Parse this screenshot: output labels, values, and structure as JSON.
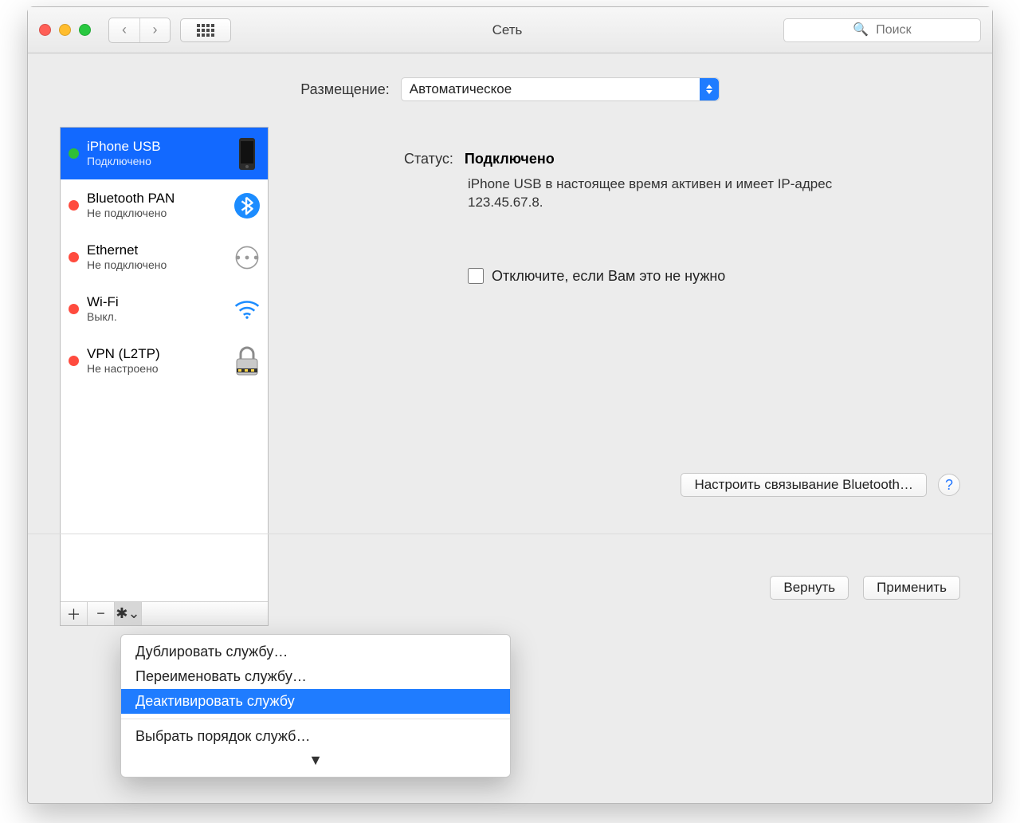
{
  "window": {
    "title": "Сеть"
  },
  "toolbar": {
    "search_placeholder": "Поиск"
  },
  "location": {
    "label": "Размещение:",
    "value": "Автоматическое"
  },
  "services": [
    {
      "name": "iPhone USB",
      "status": "Подключено",
      "dot": "green",
      "icon": "phone",
      "selected": true
    },
    {
      "name": "Bluetooth PAN",
      "status": "Не подключено",
      "dot": "red",
      "icon": "bt",
      "selected": false
    },
    {
      "name": "Ethernet",
      "status": "Не подключено",
      "dot": "red",
      "icon": "eth",
      "selected": false
    },
    {
      "name": "Wi-Fi",
      "status": "Выкл.",
      "dot": "red",
      "icon": "wifi",
      "selected": false
    },
    {
      "name": "VPN (L2TP)",
      "status": "Не настроено",
      "dot": "red",
      "icon": "lock",
      "selected": false
    }
  ],
  "detail": {
    "status_label": "Статус:",
    "status_value": "Подключено",
    "status_desc": "iPhone USB  в настоящее время активен и имеет IP-адрес 123.45.67.8.",
    "disable_checkbox": "Отключите, если Вам это не нужно",
    "configure_button": "Настроить связывание Bluetooth…"
  },
  "footer": {
    "revert": "Вернуть",
    "apply": "Применить"
  },
  "gear_menu": {
    "items": [
      "Дублировать службу…",
      "Переименовать службу…",
      "Деактивировать службу",
      "---",
      "Выбрать порядок служб…"
    ],
    "highlighted_index": 2
  }
}
